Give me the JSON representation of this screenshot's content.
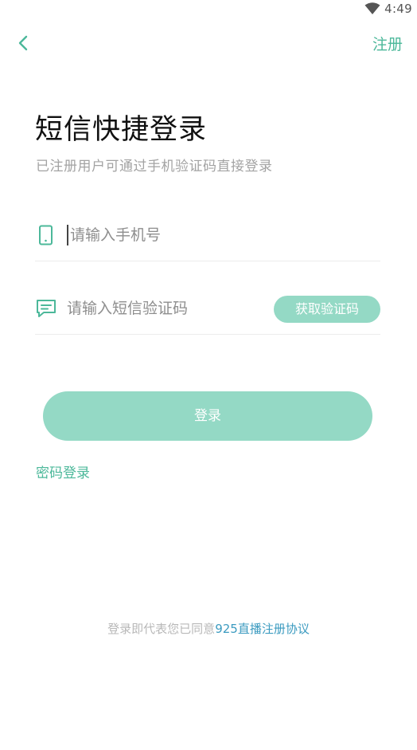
{
  "status_bar": {
    "time": "4:49",
    "wifi_icon": "wifi-icon"
  },
  "nav": {
    "back_icon": "chevron-left-icon",
    "register_label": "注册"
  },
  "header": {
    "title": "短信快捷登录",
    "subtitle": "已注册用户可通过手机验证码直接登录"
  },
  "form": {
    "phone": {
      "icon": "phone-icon",
      "placeholder": "请输入手机号",
      "value": ""
    },
    "code": {
      "icon": "message-icon",
      "placeholder": "请输入短信验证码",
      "value": "",
      "get_code_label": "获取验证码"
    },
    "login_label": "登录",
    "password_login_label": "密码登录"
  },
  "agreement": {
    "prefix": "登录即代表您已同意",
    "link_text": "925直播注册协议"
  },
  "colors": {
    "accent": "#4cb89a",
    "button_fill": "#94d9c5",
    "link_blue": "#3c9bc0"
  }
}
